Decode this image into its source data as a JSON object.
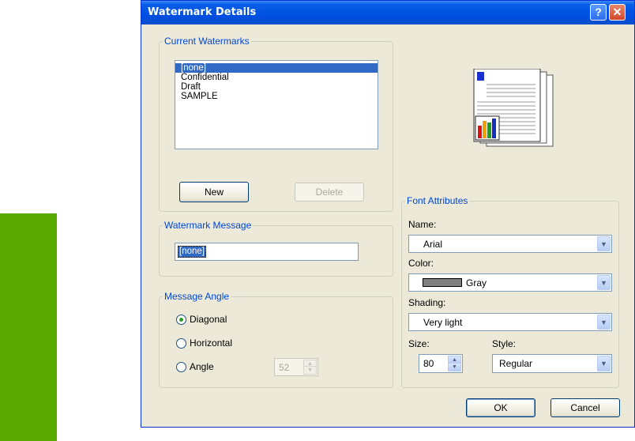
{
  "dialog": {
    "title": "Watermark Details",
    "help_glyph": "?",
    "close_glyph": "✕"
  },
  "current_watermarks": {
    "legend": "Current Watermarks",
    "items": [
      "[none]",
      "Confidential",
      "Draft",
      "SAMPLE"
    ],
    "selected_index": 0,
    "new_button": "New",
    "delete_button": "Delete"
  },
  "watermark_message": {
    "legend": "Watermark Message",
    "value": "[none]"
  },
  "message_angle": {
    "legend": "Message Angle",
    "options": [
      "Diagonal",
      "Horizontal",
      "Angle"
    ],
    "selected": "Diagonal",
    "angle_value": "52"
  },
  "font_attributes": {
    "legend": "Font Attributes",
    "name_label": "Name:",
    "name_value": "Arial",
    "color_label": "Color:",
    "color_value": "Gray",
    "color_swatch": "#808080",
    "shading_label": "Shading:",
    "shading_value": "Very light",
    "size_label": "Size:",
    "size_value": "80",
    "style_label": "Style:",
    "style_value": "Regular"
  },
  "footer": {
    "ok_button": "OK",
    "cancel_button": "Cancel"
  },
  "icons": {
    "dropdown": "chevron-down-icon",
    "preview": "page-preview-icon"
  },
  "colors": {
    "titlebar": "#0054e3",
    "legend_text": "#0046d5",
    "selection": "#316ac5",
    "dialog_bg": "#ece9d8",
    "side_bar": "#5aaa00"
  }
}
